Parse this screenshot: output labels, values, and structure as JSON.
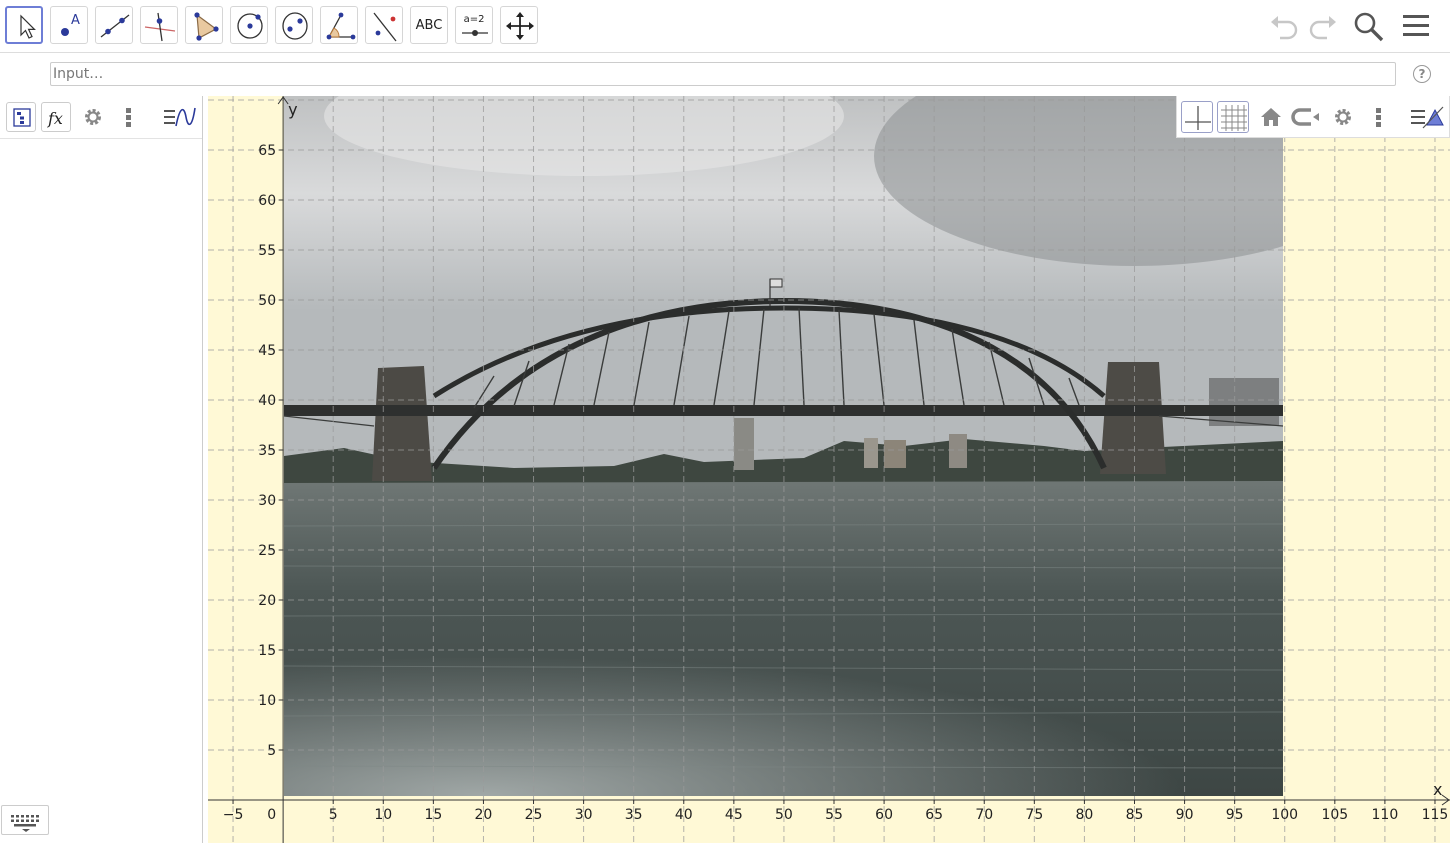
{
  "toolbar": {
    "tools": [
      {
        "name": "move-tool",
        "selected": true
      },
      {
        "name": "point-tool"
      },
      {
        "name": "line-tool"
      },
      {
        "name": "perpendicular-line-tool"
      },
      {
        "name": "polygon-tool"
      },
      {
        "name": "circle-center-point-tool"
      },
      {
        "name": "ellipse-tool"
      },
      {
        "name": "angle-tool"
      },
      {
        "name": "reflect-tool"
      },
      {
        "name": "text-tool",
        "label": "ABC"
      },
      {
        "name": "slider-tool",
        "label": "a=2"
      },
      {
        "name": "move-graphics-view-tool"
      }
    ],
    "icons": [
      "undo-icon",
      "redo-icon",
      "search-icon",
      "menu-icon"
    ]
  },
  "input": {
    "placeholder": "Input…"
  },
  "algebra_view": {
    "header_icons": [
      "algebra-tree-icon",
      "fx-icon",
      "gear-icon",
      "more-vert-icon",
      "graph-toggle-icon"
    ]
  },
  "graphics_view": {
    "style_bar_icons": [
      "axes-toggle-icon",
      "grid-toggle-icon",
      "home-icon",
      "navigation-bar-icon",
      "gear-icon",
      "more-vert-icon",
      "style-bar-toggle-icon"
    ],
    "background_color": "#fff9d6",
    "image": "Sydney Harbour Bridge photo",
    "axes": {
      "x_label": "x",
      "y_label": "y",
      "origin_label": "0",
      "x_ticks": [
        "−5",
        "5",
        "10",
        "15",
        "20",
        "25",
        "30",
        "35",
        "40",
        "45",
        "50",
        "55",
        "60",
        "65",
        "70",
        "75",
        "80",
        "85",
        "90",
        "95",
        "100",
        "105",
        "110",
        "115"
      ],
      "y_ticks": [
        "5",
        "10",
        "15",
        "20",
        "25",
        "30",
        "35",
        "40",
        "45",
        "50",
        "55",
        "60",
        "65"
      ],
      "x_range": [
        -7.5,
        116.5
      ],
      "y_range": [
        -4.3,
        70.4
      ],
      "grid_spacing": 5,
      "image_extent": {
        "x": [
          0,
          100
        ],
        "y": [
          0,
          70
        ]
      }
    }
  }
}
